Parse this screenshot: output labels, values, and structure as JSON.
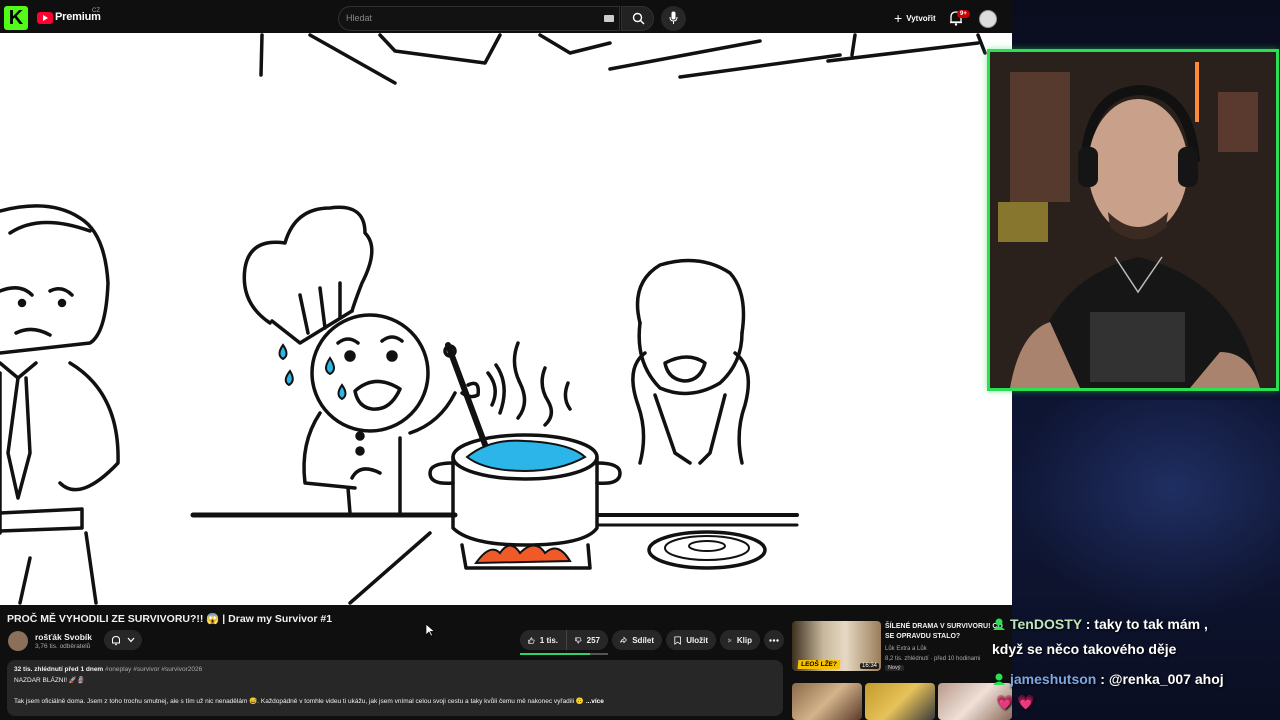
{
  "header": {
    "kick_logo_letter": "K",
    "brand": "Premium",
    "brand_region": "CZ",
    "search_placeholder": "Hledat",
    "create_label": "Vytvořit",
    "notification_count": "9+"
  },
  "video": {
    "title": "PROČ MĚ VYHODILI ZE SURVIVORU?!! 😱 | Draw my Survivor #1",
    "channel_name": "rošťák Svobík",
    "subscribers": "3,76 tis. odběratelů"
  },
  "actions": {
    "likes": "1 tis.",
    "dislikes": "257",
    "share": "Sdílet",
    "save": "Uložit",
    "clip": "Klip",
    "like_ratio": 0.8
  },
  "description": {
    "views_date": "32 tis. zhlédnutí  před 1 dnem",
    "hashtags": "#oneplay #survivor #survivor2026",
    "line1": "NAZDAR BLÁZNI! 🚀🗿",
    "line2": "Tak jsem oficiálně doma. Jsem z toho trochu smutnej, ale s tím už nic nenadělám 😅. Každopádně v tomhle videu ti ukážu, jak jsem vnímal celou svoji cestu a taky kvůli čemu mě nakonec vyřadili 🙃",
    "more": "...více"
  },
  "recommended": {
    "title": "ŠÍLENÉ DRAMA V SURVIVORU! CO SE OPRAVDU STALO?",
    "channel": "Lůk Extra a Lůk",
    "meta": "8,2 tis. zhlédnutí · před 10 hodinami",
    "badge": "Nový",
    "thumb_banner": "LEOŠ LŽE?",
    "duration": "16:34"
  },
  "chat": [
    {
      "user": "TenDOSTY",
      "sep": " : ",
      "message": "taky to tak mám ,",
      "continuation": "když se něco takového děje"
    },
    {
      "user": "jameshutson",
      "sep": " : ",
      "message": "@renka_007 ahoj",
      "emotes": "💗 💗"
    }
  ],
  "colors": {
    "kick_green": "#53fc18",
    "yt_red": "#ff0033",
    "cam_border": "#2adf52",
    "like_bar": "#2dd36f"
  }
}
